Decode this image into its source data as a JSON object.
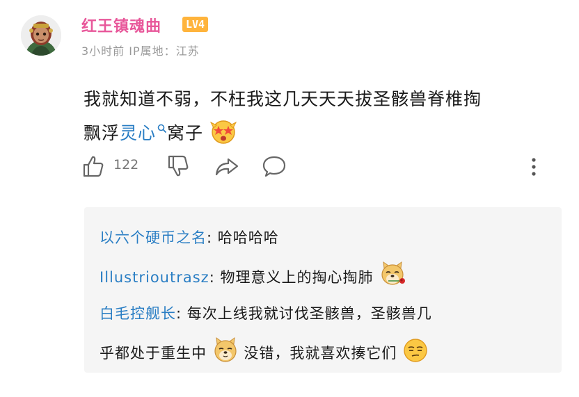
{
  "comment": {
    "user": {
      "name": "红王镇魂曲",
      "level_badge": "LV4",
      "name_color": "#e8579a",
      "badge_color": "#ffb43c"
    },
    "meta": {
      "time": "3小时前",
      "ip_location": "IP属地：江苏"
    },
    "body": {
      "line1": "我就知道不弱，不枉我这几天天天拔圣骸兽脊椎掏",
      "line2_pre": "飘浮",
      "topic_link": "灵心",
      "line2_post": "窝子",
      "emoji": "starry-eyed-face-emoji"
    },
    "actions": {
      "like_count": "122"
    }
  },
  "replies": [
    {
      "name": "以六个硬币之名",
      "colon": ": ",
      "text": "哈哈哈哈"
    },
    {
      "name": "Illustrioutrasz",
      "colon": ": ",
      "text": "物理意义上的掏心掏肺",
      "emoji": "doge-rose-emoji"
    },
    {
      "name": "白毛控舰长",
      "colon": ": ",
      "text1": "每次上线我就讨伐圣骸兽，圣骸兽几",
      "text2_pre": "乎都处于重生中",
      "text2_mid": "没错，我就喜欢揍它们",
      "emoji1": "doge-emoji",
      "emoji2": "smug-face-emoji"
    }
  ],
  "colors": {
    "link": "#2a7ec4",
    "meta": "#999999",
    "reply_bg": "#f5f5f5"
  }
}
